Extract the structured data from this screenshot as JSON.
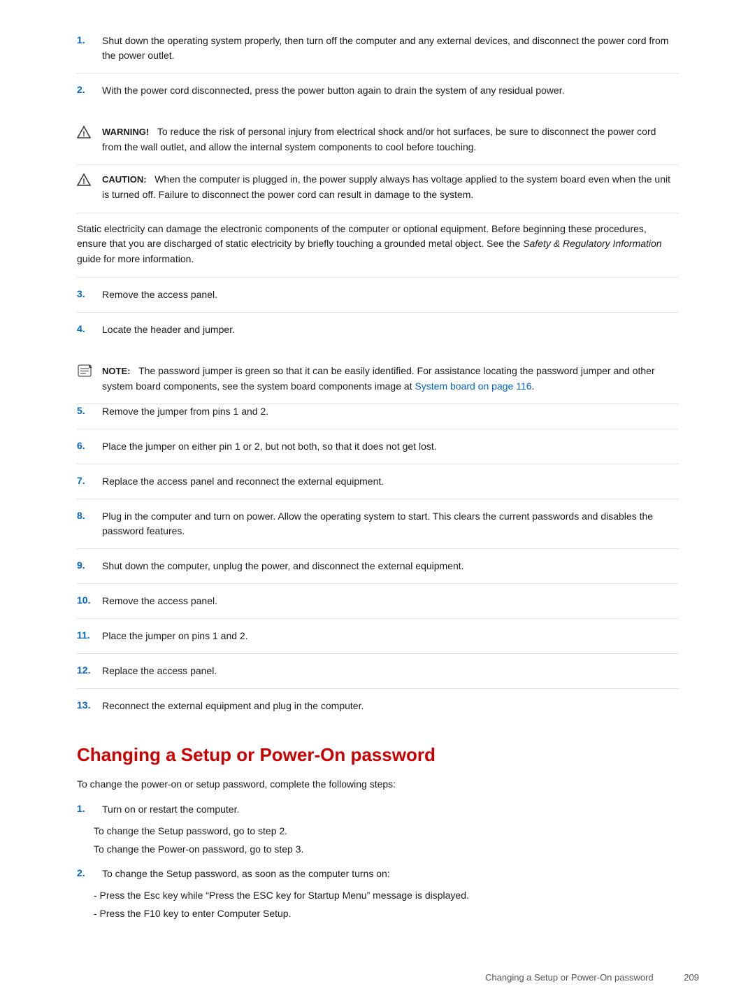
{
  "steps_part1": [
    {
      "number": "1.",
      "text": "Shut down the operating system properly, then turn off the computer and any external devices, and disconnect the power cord from the power outlet."
    },
    {
      "number": "2.",
      "text": "With the power cord disconnected, press the power button again to drain the system of any residual power."
    }
  ],
  "warning": {
    "label": "WARNING!",
    "text": "To reduce the risk of personal injury from electrical shock and/or hot surfaces, be sure to disconnect the power cord from the wall outlet, and allow the internal system components to cool before touching."
  },
  "caution": {
    "label": "CAUTION:",
    "text": "When the computer is plugged in, the power supply always has voltage applied to the system board even when the unit is turned off. Failure to disconnect the power cord can result in damage to the system."
  },
  "static_para": {
    "text_before_italic": "Static electricity can damage the electronic components of the computer or optional equipment. Before beginning these procedures, ensure that you are discharged of static electricity by briefly touching a grounded metal object. See the ",
    "italic_text": "Safety & Regulatory Information",
    "text_after_italic": " guide for more information."
  },
  "steps_part2": [
    {
      "number": "3.",
      "text": "Remove the access panel."
    },
    {
      "number": "4.",
      "text": "Locate the header and jumper."
    }
  ],
  "note": {
    "label": "NOTE:",
    "text_before_link": "The password jumper is green so that it can be easily identified. For assistance locating the password jumper and other system board components, see the system board components image at ",
    "link_text": "System board on page 116",
    "link_href": "#",
    "text_after_link": "."
  },
  "steps_part3": [
    {
      "number": "5.",
      "text": "Remove the jumper from pins 1 and 2."
    },
    {
      "number": "6.",
      "text": "Place the jumper on either pin 1 or 2, but not both, so that it does not get lost."
    },
    {
      "number": "7.",
      "text": "Replace the access panel and reconnect the external equipment."
    },
    {
      "number": "8.",
      "text": "Plug in the computer and turn on power. Allow the operating system to start. This clears the current passwords and disables the password features."
    },
    {
      "number": "9.",
      "text": "Shut down the computer, unplug the power, and disconnect the external equipment."
    },
    {
      "number": "10.",
      "text": "Remove the access panel."
    },
    {
      "number": "11.",
      "text": "Place the jumper on pins 1 and 2."
    },
    {
      "number": "12.",
      "text": "Replace the access panel."
    },
    {
      "number": "13.",
      "text": "Reconnect the external equipment and plug in the computer."
    }
  ],
  "section_heading": "Changing a Setup or Power-On password",
  "section_intro": "To change the power-on or setup password, complete the following steps:",
  "section_steps": [
    {
      "number": "1.",
      "text": "Turn on or restart the computer.",
      "sub_steps": [
        "To change the Setup password, go to step 2.",
        "To change the Power-on password, go to step 3."
      ]
    },
    {
      "number": "2.",
      "text": "To change the Setup password, as soon as the computer turns on:",
      "sub_steps": [
        "- Press the Esc key while “Press the ESC key for Startup Menu” message is displayed.",
        "- Press the F10 key to enter Computer Setup."
      ]
    }
  ],
  "footer": {
    "left": "Changing a Setup or Power-On password",
    "right": "209"
  }
}
